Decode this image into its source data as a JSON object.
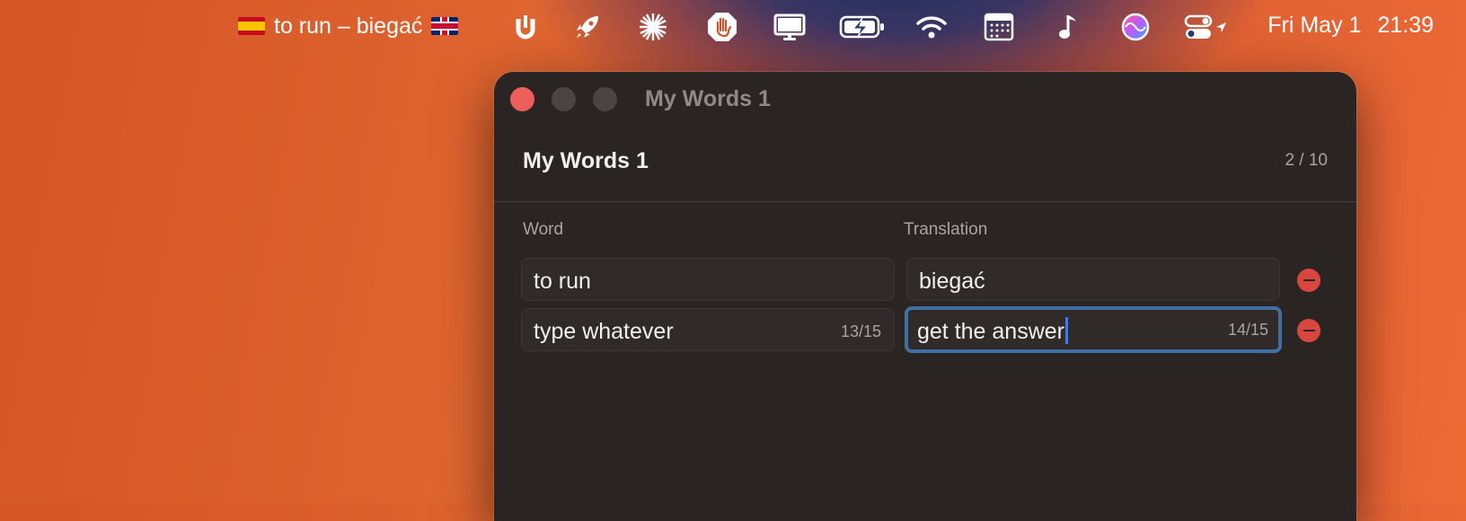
{
  "menubar": {
    "now_playing": "to run – biegać",
    "clock_day": "Fri May 1",
    "clock_time": "21:39",
    "icons": [
      "spain-flag-icon",
      "uk-flag-icon",
      "u-magnet-icon",
      "rocket-icon",
      "sparkle-icon",
      "hand-stop-icon",
      "display-icon",
      "battery-charging-icon",
      "wifi-icon",
      "calendar-icon",
      "music-note-icon",
      "siri-icon",
      "control-center-icon",
      "location-arrow-icon"
    ]
  },
  "window": {
    "title": "My Words 1",
    "list_title": "My Words 1",
    "count": "2 / 10",
    "columns": {
      "word": "Word",
      "translation": "Translation"
    },
    "rows": [
      {
        "word": "to run",
        "word_counter": "",
        "translation": "biegać",
        "translation_counter": ""
      },
      {
        "word": "type whatever",
        "word_counter": "13/15",
        "translation": "get the answer",
        "translation_counter": "14/15"
      }
    ]
  },
  "colors": {
    "window_bg": "#2a2523",
    "focus_ring": "#3f6fa3",
    "remove_button": "#d8473f",
    "close_button": "#ec5f5a"
  }
}
